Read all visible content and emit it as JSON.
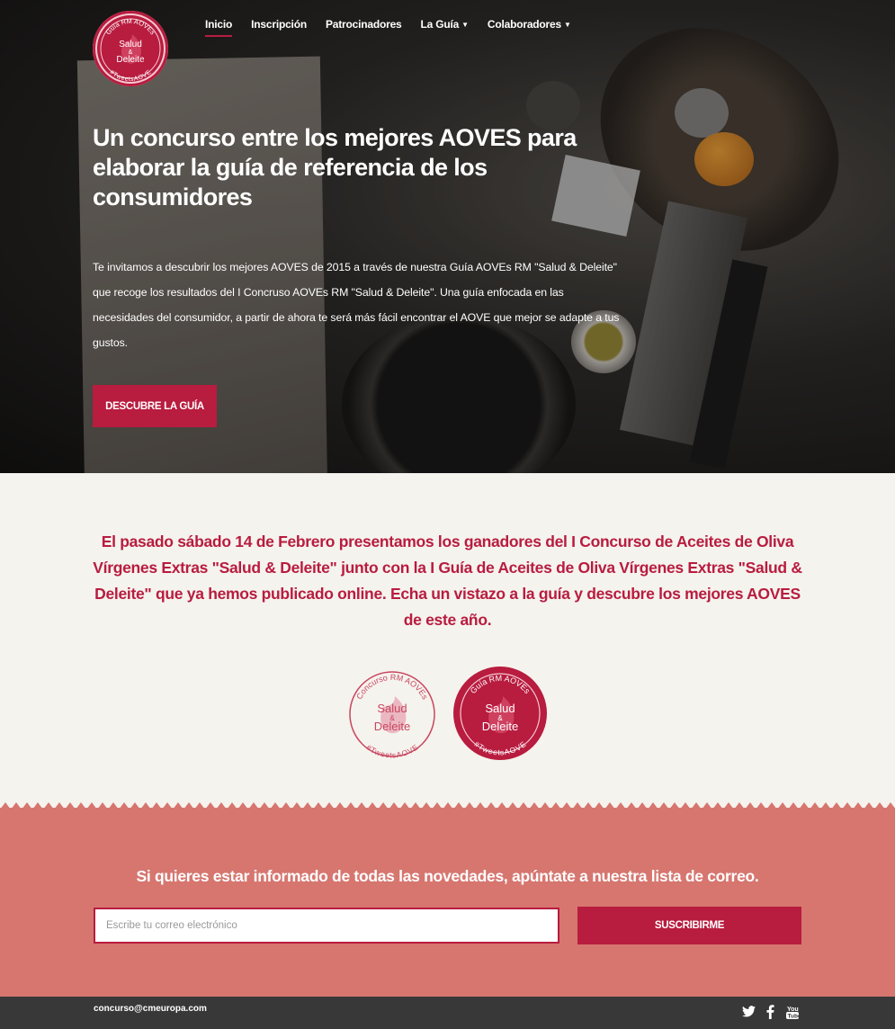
{
  "nav": {
    "items": [
      {
        "label": "Inicio",
        "active": true,
        "dropdown": false
      },
      {
        "label": "Inscripción",
        "active": false,
        "dropdown": false
      },
      {
        "label": "Patrocinadores",
        "active": false,
        "dropdown": false
      },
      {
        "label": "La Guía",
        "active": false,
        "dropdown": true
      },
      {
        "label": "Colaboradores",
        "active": false,
        "dropdown": true
      }
    ]
  },
  "logo": {
    "top_text": "Guía RM AOVEs",
    "line1": "Salud",
    "line2": "&",
    "line3": "Deleite",
    "bottom_text": "#TweetsAOVE"
  },
  "hero": {
    "title": "Un concurso entre los mejores AOVES para elaborar la guía de referencia de los consumidores",
    "text": "Te invitamos a descubrir los mejores AOVES de 2015 a través de nuestra Guía AOVEs RM \"Salud & Deleite\" que recoge los resultados del I Concruso AOVEs RM \"Salud & Deleite\". Una guía enfocada en las necesidades del consumidor, a partir de ahora te será más fácil encontrar el AOVE que mejor se adapte a tus gustos.",
    "button": "DESCUBRE LA GUÍA"
  },
  "announce": {
    "text": "El pasado sábado 14 de Febrero presentamos los ganadores del I Concurso de Aceites de Oliva Vírgenes Extras \"Salud & Deleite\" junto con la I Guía de Aceites de Oliva Vírgenes Extras \"Salud & Deleite\" que ya hemos publicado online. Echa un vistazo a la guía y descubre los mejores AOVES de este año.",
    "badge1": {
      "top_text": "Concurso RM AOVEs",
      "line1": "Salud",
      "line2": "&",
      "line3": "Deleite",
      "bottom_text": "#TweetsAOVE"
    },
    "badge2": {
      "top_text": "Guía RM AOVEs",
      "line1": "Salud",
      "line2": "&",
      "line3": "Deleite",
      "bottom_text": "#TweetsAOVE"
    }
  },
  "newsletter": {
    "title": "Si quieres estar informado de todas las novedades, apúntate a nuestra lista de correo.",
    "placeholder": "Escribe tu correo electrónico",
    "button": "SUSCRIBIRME"
  },
  "footer": {
    "email": "concurso@cmeuropa.com",
    "social": [
      "twitter-icon",
      "facebook-icon",
      "youtube-icon"
    ]
  },
  "colors": {
    "brand": "#b81c3f",
    "newsletter_bg": "#d6766f",
    "footer_bg": "#393838",
    "announce_bg": "#f5f3ee"
  }
}
